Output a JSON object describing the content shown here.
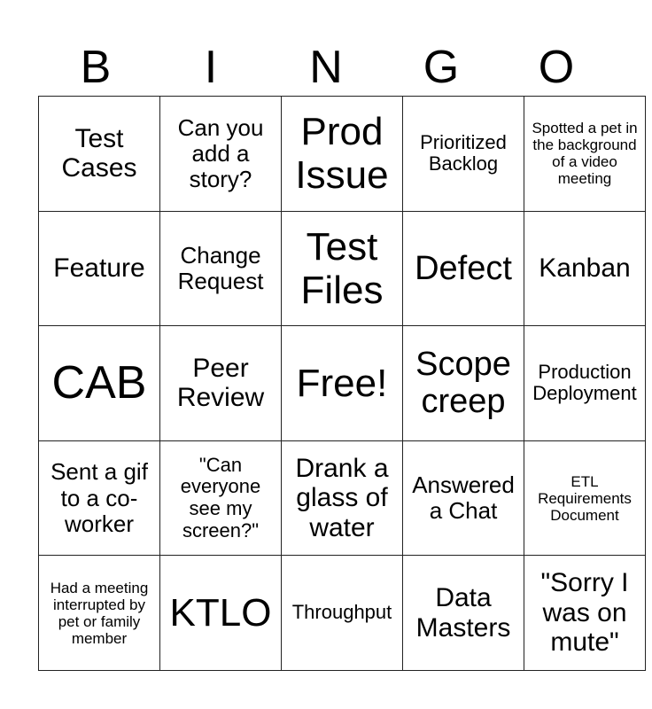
{
  "header": [
    "B",
    "I",
    "N",
    "G",
    "O"
  ],
  "cells": [
    [
      "Test Cases",
      "Can you add a story?",
      "Prod Issue",
      "Prioritized Backlog",
      "Spotted a pet in the background of a video meeting"
    ],
    [
      "Feature",
      "Change Request",
      "Test Files",
      "Defect",
      "Kanban"
    ],
    [
      "CAB",
      "Peer Review",
      "Free!",
      "Scope creep",
      "Production Deployment"
    ],
    [
      "Sent a gif to a co-worker",
      "\"Can everyone see my screen?\"",
      "Drank a glass of water",
      "Answered a Chat",
      "ETL Requirements Document"
    ],
    [
      "Had a meeting interrupted by pet or family member",
      "KTLO",
      "Throughput",
      "Data Masters",
      "\"Sorry I was on mute\""
    ]
  ]
}
